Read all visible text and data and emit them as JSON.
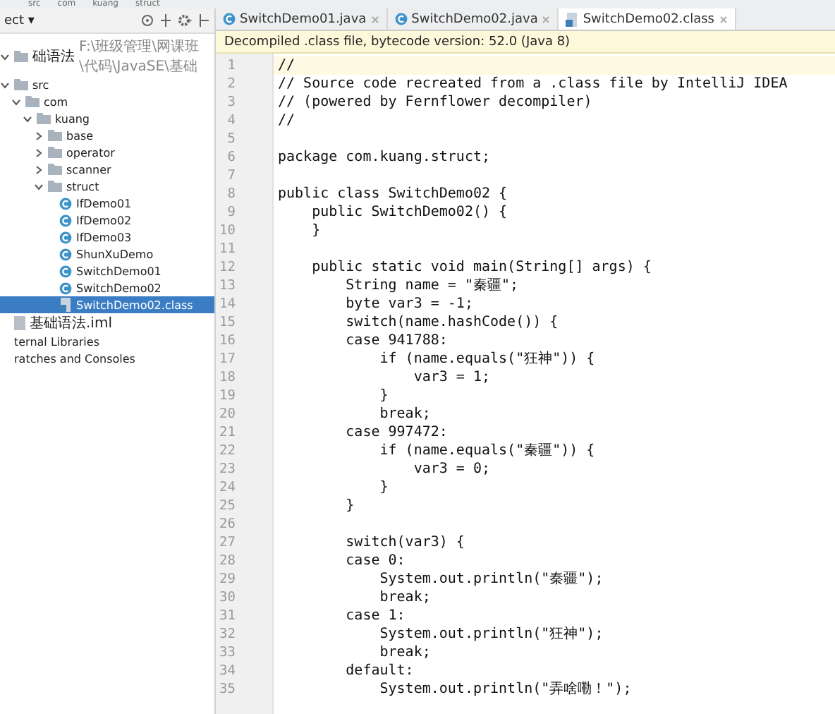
{
  "breadcrumbs": [
    "src",
    "com",
    "kuang",
    "struct"
  ],
  "project_panel": {
    "title": "ect",
    "menu_caret": "▾",
    "tree": [
      {
        "kind": "module",
        "label": "础语法",
        "path": "F:\\班级管理\\网课班\\代码\\JavaSE\\基础",
        "selected": false,
        "expanded": true,
        "children": [
          {
            "kind": "folder",
            "label": "src",
            "selected": false,
            "expanded": true,
            "children": [
              {
                "kind": "folder",
                "label": "com",
                "selected": false,
                "expanded": true,
                "children": [
                  {
                    "kind": "package",
                    "label": "kuang",
                    "selected": false,
                    "expanded": true,
                    "children": [
                      {
                        "kind": "package",
                        "label": "base",
                        "selected": false,
                        "expanded": false
                      },
                      {
                        "kind": "package",
                        "label": "operator",
                        "selected": false,
                        "expanded": false
                      },
                      {
                        "kind": "package",
                        "label": "scanner",
                        "selected": false,
                        "expanded": false
                      },
                      {
                        "kind": "package",
                        "label": "struct",
                        "selected": false,
                        "expanded": true,
                        "children": [
                          {
                            "kind": "class",
                            "label": "IfDemo01",
                            "selected": false
                          },
                          {
                            "kind": "class",
                            "label": "IfDemo02",
                            "selected": false
                          },
                          {
                            "kind": "class",
                            "label": "IfDemo03",
                            "selected": false
                          },
                          {
                            "kind": "class",
                            "label": "ShunXuDemo",
                            "selected": false
                          },
                          {
                            "kind": "class",
                            "label": "SwitchDemo01",
                            "selected": false
                          },
                          {
                            "kind": "class",
                            "label": "SwitchDemo02",
                            "selected": false
                          },
                          {
                            "kind": "class-file",
                            "label": "SwitchDemo02.class",
                            "selected": true
                          }
                        ]
                      }
                    ]
                  }
                ]
              }
            ]
          },
          {
            "kind": "iml",
            "label": "基础语法.iml",
            "selected": false
          }
        ]
      },
      {
        "kind": "libraries",
        "label": "ternal Libraries",
        "selected": false
      },
      {
        "kind": "scratches",
        "label": "ratches and Consoles",
        "selected": false
      }
    ]
  },
  "tabs": [
    {
      "kind": "class",
      "label": "SwitchDemo01.java",
      "selected": false
    },
    {
      "kind": "class",
      "label": "SwitchDemo02.java",
      "selected": false
    },
    {
      "kind": "class-file",
      "label": "SwitchDemo02.class",
      "selected": true
    }
  ],
  "notice": "Decompiled .class file, bytecode version: 52.0 (Java 8)",
  "editor": {
    "lines": [
      {
        "number": "1",
        "code": "//",
        "current": true
      },
      {
        "number": "2",
        "code": "// Source code recreated from a .class file by IntelliJ IDEA",
        "current": false
      },
      {
        "number": "3",
        "code": "// (powered by Fernflower decompiler)",
        "current": false
      },
      {
        "number": "4",
        "code": "//",
        "current": false
      },
      {
        "number": "5",
        "current": false
      },
      {
        "number": "6",
        "code": "package com.kuang.struct;",
        "current": false
      },
      {
        "number": "7",
        "current": false
      },
      {
        "number": "8",
        "code": "public class SwitchDemo02 {",
        "current": false
      },
      {
        "number": "9",
        "code": "    public SwitchDemo02() {",
        "current": false
      },
      {
        "number": "10",
        "code": "    }",
        "current": false
      },
      {
        "number": "11",
        "current": false
      },
      {
        "number": "12",
        "code": "    public static void main(String[] args) {",
        "current": false
      },
      {
        "number": "13",
        "code": "        String name = \"秦疆\";",
        "current": false
      },
      {
        "number": "14",
        "code": "        byte var3 = -1;",
        "current": false
      },
      {
        "number": "15",
        "code": "        switch(name.hashCode()) {",
        "current": false
      },
      {
        "number": "16",
        "code": "        case 941788:",
        "current": false
      },
      {
        "number": "17",
        "code": "            if (name.equals(\"狂神\")) {",
        "current": false
      },
      {
        "number": "18",
        "code": "                var3 = 1;",
        "current": false
      },
      {
        "number": "19",
        "code": "            }",
        "current": false
      },
      {
        "number": "20",
        "code": "            break;",
        "current": false
      },
      {
        "number": "21",
        "code": "        case 997472:",
        "current": false
      },
      {
        "number": "22",
        "code": "            if (name.equals(\"秦疆\")) {",
        "current": false
      },
      {
        "number": "23",
        "code": "                var3 = 0;",
        "current": false
      },
      {
        "number": "24",
        "code": "            }",
        "current": false
      },
      {
        "number": "25",
        "code": "        }",
        "current": false
      },
      {
        "number": "26",
        "current": false
      },
      {
        "number": "27",
        "code": "        switch(var3) {",
        "current": false
      },
      {
        "number": "28",
        "code": "        case 0:",
        "current": false
      },
      {
        "number": "29",
        "code": "            System.out.println(\"秦疆\");",
        "current": false
      },
      {
        "number": "30",
        "code": "            break;",
        "current": false
      },
      {
        "number": "31",
        "code": "        case 1:",
        "current": false
      },
      {
        "number": "32",
        "code": "            System.out.println(\"狂神\");",
        "current": false
      },
      {
        "number": "33",
        "code": "            break;",
        "current": false
      },
      {
        "number": "34",
        "code": "        default:",
        "current": false
      },
      {
        "number": "35",
        "code": "            System.out.println(\"弄啥嘞！\");",
        "current": false
      }
    ]
  }
}
